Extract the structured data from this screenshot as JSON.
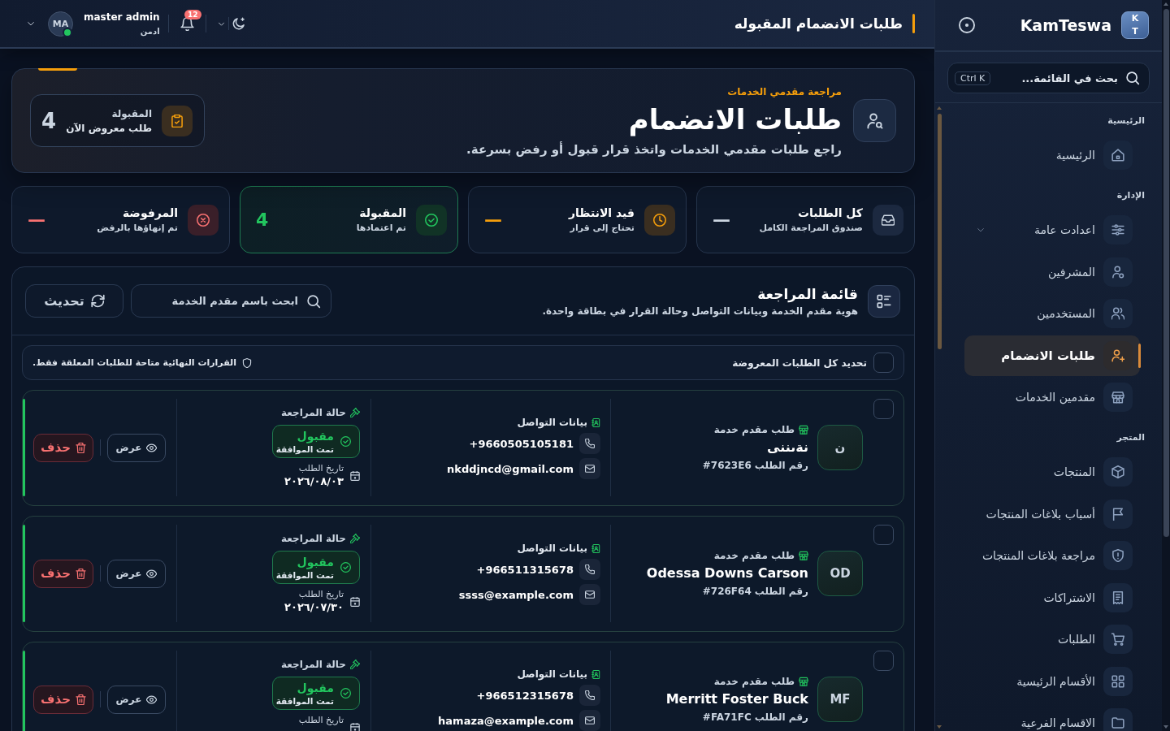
{
  "header": {
    "title": "طلبات الانضمام المقبوله",
    "notification_count": "12",
    "user": {
      "name": "master admin",
      "role": "ادمن",
      "initials": "MA",
      "online": true
    }
  },
  "sidebar": {
    "brand": {
      "logo": "KT",
      "name": "KamTeswa"
    },
    "search": {
      "placeholder": "بحث في القائمة...",
      "shortcut": "Ctrl K"
    },
    "sections": [
      {
        "title": "الرئيسية",
        "items": [
          {
            "label": "الرئيسية",
            "kind": "link",
            "selected": false
          }
        ]
      },
      {
        "title": "الإدارة",
        "items": [
          {
            "label": "اعدادت عامة",
            "kind": "group",
            "selected": false
          },
          {
            "label": "المشرفين",
            "kind": "link",
            "selected": false
          },
          {
            "label": "المستخدمين",
            "kind": "link",
            "selected": false
          },
          {
            "label": "طلبات الانضمام",
            "kind": "link",
            "selected": true
          },
          {
            "label": "مقدمين الخدمات",
            "kind": "link",
            "selected": false
          }
        ]
      },
      {
        "title": "المتجر",
        "items": [
          {
            "label": "المنتجات",
            "kind": "link",
            "selected": false
          },
          {
            "label": "أسباب بلاغات المنتجات",
            "kind": "link",
            "selected": false
          },
          {
            "label": "مراجعة بلاغات المنتجات",
            "kind": "link",
            "selected": false
          },
          {
            "label": "الاشتراكات",
            "kind": "link",
            "selected": false
          },
          {
            "label": "الطلبات",
            "kind": "link",
            "selected": false
          },
          {
            "label": "الأقسام الرئيسية",
            "kind": "link",
            "selected": false
          },
          {
            "label": "الاقسام الفرعية",
            "kind": "link",
            "selected": false
          }
        ]
      }
    ]
  },
  "hero": {
    "eyebrow": "مراجعة مقدمي الخدمات",
    "title": "طلبات الانضمام",
    "subtitle": "راجع طلبات مقدمي الخدمات واتخذ قرار قبول أو رفض بسرعة.",
    "summary": {
      "label": "المقبولة",
      "caption": "طلب معروض الآن",
      "value": "4"
    }
  },
  "stats": [
    {
      "kind": "all",
      "title": "كل الطلبات",
      "caption": "صندوق المراجعة الكامل",
      "value": "—",
      "selected": false
    },
    {
      "kind": "pending",
      "title": "قيد الانتظار",
      "caption": "تحتاج إلى قرار",
      "value": "—",
      "selected": false
    },
    {
      "kind": "accepted",
      "title": "المقبولة",
      "caption": "تم اعتمادها",
      "value": "4",
      "selected": true
    },
    {
      "kind": "rejected",
      "title": "المرفوضة",
      "caption": "تم إنهاؤها بالرفض",
      "value": "—",
      "selected": false
    }
  ],
  "review_list": {
    "title": "قائمة المراجعة",
    "subtitle": "هوية مقدم الخدمة وبيانات التواصل وحالة القرار في بطاقة واحدة.",
    "search": {
      "placeholder": "ابحث باسم مقدم الخدمة"
    },
    "refresh_button": "تحديث",
    "select_all": {
      "label": "تحديد كل الطلبات المعروضة",
      "checked": false
    },
    "notice": "القرارات النهائية متاحة للطلبات المعلقة فقط.",
    "requests": [
      {
        "checked": false,
        "initials": "ن",
        "type_label": "طلب مقدم خدمة",
        "name": "نةىننى",
        "order_label": "رقم الطلب",
        "order_number": "#7623E6",
        "contact_label": "بيانات التواصل",
        "phone": "+9660505105181",
        "email": "nkddjncd@gmail.com",
        "status_label": "حالة المراجعة",
        "status": {
          "kind": "accepted",
          "label": "مقبول",
          "note": "تمت الموافقة"
        },
        "date_label": "تاريخ الطلب",
        "date": "٢٠٢٦/٠٨/٠٣",
        "view_button": "عرض",
        "delete_button": "حذف"
      },
      {
        "checked": false,
        "initials": "OD",
        "type_label": "طلب مقدم خدمة",
        "name": "Odessa Downs Carson",
        "order_label": "رقم الطلب",
        "order_number": "#726F64",
        "contact_label": "بيانات التواصل",
        "phone": "+966511315678",
        "email": "ssss@example.com",
        "status_label": "حالة المراجعة",
        "status": {
          "kind": "accepted",
          "label": "مقبول",
          "note": "تمت الموافقة"
        },
        "date_label": "تاريخ الطلب",
        "date": "٢٠٢٦/٠٧/٣٠",
        "view_button": "عرض",
        "delete_button": "حذف"
      },
      {
        "checked": false,
        "initials": "MF",
        "type_label": "طلب مقدم خدمة",
        "name": "Merritt Foster Buck",
        "order_label": "رقم الطلب",
        "order_number": "#FA71FC",
        "contact_label": "بيانات التواصل",
        "phone": "+966512315678",
        "email": "hamaza@example.com",
        "status_label": "حالة المراجعة",
        "status": {
          "kind": "accepted",
          "label": "مقبول",
          "note": "تمت الموافقة"
        },
        "date_label": "تاريخ الطلب",
        "view_button": "عرض",
        "delete_button": "حذف"
      }
    ]
  }
}
